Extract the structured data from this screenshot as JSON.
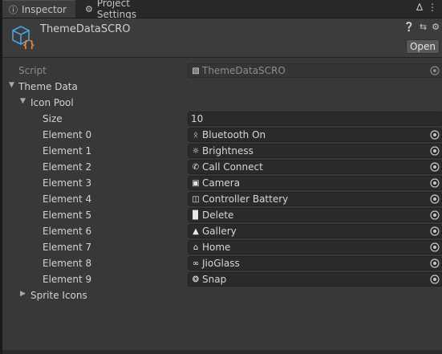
{
  "tabs": {
    "inspector": {
      "label": "Inspector",
      "icon": "info-icon"
    },
    "project_settings": {
      "label": "Project Settings",
      "icon": "gear-icon"
    },
    "tools": [
      "lock-icon",
      "kebab-menu-icon"
    ]
  },
  "header": {
    "object_name": "ThemeDataSCRO",
    "icon": "script-asset-icon",
    "tools": [
      "help-icon",
      "presets-icon",
      "settings-icon"
    ],
    "open_button": "Open"
  },
  "script_field": {
    "label": "Script",
    "value": "ThemeDataSCRO",
    "icon": "script-file-icon",
    "enabled": false
  },
  "theme_data": {
    "label": "Theme Data",
    "expanded": true,
    "icon_pool": {
      "label": "Icon Pool",
      "expanded": true,
      "size_label": "Size",
      "size_value": "10",
      "elements": [
        {
          "label": "Element 0",
          "value": "Bluetooth On",
          "icon": "bluetooth-icon"
        },
        {
          "label": "Element 1",
          "value": "Brightness",
          "icon": "brightness-icon"
        },
        {
          "label": "Element 2",
          "value": "Call Connect",
          "icon": "phone-icon"
        },
        {
          "label": "Element 3",
          "value": "Camera",
          "icon": "camera-icon"
        },
        {
          "label": "Element 4",
          "value": "Controller Battery",
          "icon": "controller-battery-icon"
        },
        {
          "label": "Element 5",
          "value": "Delete",
          "icon": "trash-icon"
        },
        {
          "label": "Element 6",
          "value": "Gallery",
          "icon": "gallery-icon"
        },
        {
          "label": "Element 7",
          "value": "Home",
          "icon": "home-icon"
        },
        {
          "label": "Element 8",
          "value": "JioGlass",
          "icon": "glasses-icon"
        },
        {
          "label": "Element 9",
          "value": "Snap",
          "icon": "snap-icon"
        }
      ]
    },
    "sprite_icons": {
      "label": "Sprite Icons",
      "expanded": false
    }
  },
  "colors": {
    "background": "#383838",
    "field": "#2a2a2a",
    "accent_blue": "#4aa3df",
    "accent_orange": "#e8893a"
  }
}
